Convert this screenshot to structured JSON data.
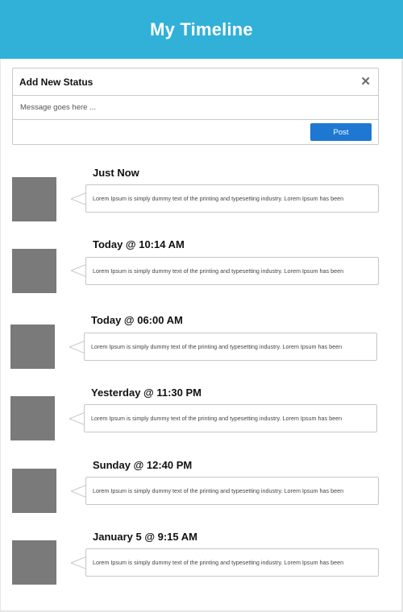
{
  "header": {
    "title": "My Timeline"
  },
  "status": {
    "title": "Add New Status",
    "close_label": "✕",
    "placeholder": "Message goes here ...",
    "post_label": "Post"
  },
  "timeline": [
    {
      "when": "Just Now",
      "text": "Lorem Ipsum is simply dummy text of the printing and typesetting industry. Lorem Ipsum has been"
    },
    {
      "when": "Today @ 10:14 AM",
      "text": "Lorem Ipsum is simply dummy text of the printing and typesetting industry. Lorem Ipsum has been"
    },
    {
      "when": "Today @ 06:00 AM",
      "text": "Lorem Ipsum is simply dummy text of the printing and typesetting industry. Lorem Ipsum has been"
    },
    {
      "when": "Yesterday @ 11:30 PM",
      "text": "Lorem Ipsum is simply dummy text of the printing and typesetting industry. Lorem Ipsum has been"
    },
    {
      "when": "Sunday @ 12:40 PM",
      "text": "Lorem Ipsum is simply dummy text of the printing and typesetting industry. Lorem Ipsum has been"
    },
    {
      "when": "January 5 @ 9:15 AM",
      "text": "Lorem Ipsum is simply dummy text of the printing and typesetting industry. Lorem Ipsum has been"
    }
  ]
}
